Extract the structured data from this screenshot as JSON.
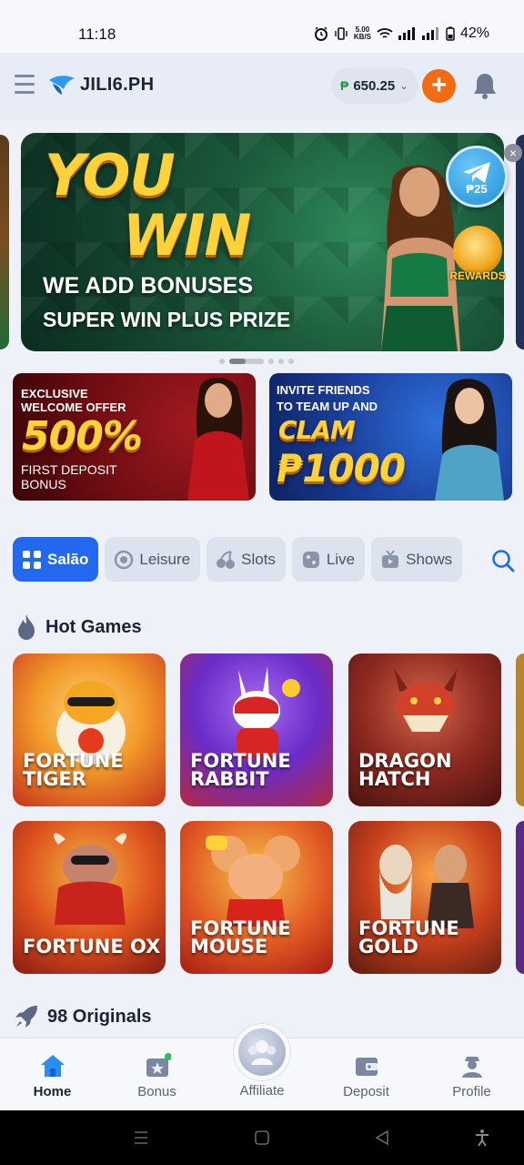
{
  "status_bar": {
    "time": "11:18",
    "speed_value": "5.00",
    "speed_unit": "KB/S",
    "battery": "42%"
  },
  "header": {
    "logo_text": "JILI6.PH",
    "currency_symbol": "₱",
    "balance": "650.25",
    "add_label": "+"
  },
  "banner": {
    "headline_line1": "YOU",
    "headline_line2": "WIN",
    "subline1": "WE ADD BONUSES",
    "subline2": "SUPER WIN PLUS PRIZE",
    "telegram_amount": "₱25",
    "rewards_label": "REWARDS",
    "close_label": "×"
  },
  "promos": [
    {
      "line1": "EXCLUSIVE",
      "line2": "WELCOME OFFER",
      "big": "500%",
      "line3": "FIRST DEPOSIT",
      "line4": "BONUS"
    },
    {
      "line1": "INVITE FRIENDS",
      "line2": "TO TEAM UP AND",
      "line3": "CLAM",
      "big": "₱1000"
    }
  ],
  "tabs": [
    {
      "label": "Salão",
      "icon": "grid-icon",
      "active": true
    },
    {
      "label": "Leisure",
      "icon": "target-icon"
    },
    {
      "label": "Slots",
      "icon": "cherry-icon"
    },
    {
      "label": "Live",
      "icon": "dice-icon"
    },
    {
      "label": "Shows",
      "icon": "tv-icon"
    }
  ],
  "hot_games": {
    "title": "Hot Games",
    "items": [
      {
        "line1": "FORTUNE",
        "line2": "TIGER"
      },
      {
        "line1": "FORTUNE",
        "line2": "RABBIT"
      },
      {
        "line1": "DRAGON",
        "line2": "HATCH"
      },
      {
        "line1": "FORTUNE OX",
        "line2": ""
      },
      {
        "line1": "FORTUNE",
        "line2": "MOUSE"
      },
      {
        "line1": "FORTUNE",
        "line2": "GOLD"
      }
    ]
  },
  "originals": {
    "title": "98 Originals"
  },
  "bottom_nav": [
    {
      "label": "Home",
      "icon": "home-icon",
      "active": true
    },
    {
      "label": "Bonus",
      "icon": "bonus-star-icon"
    },
    {
      "label": "Affiliate",
      "icon": "affiliate-icon"
    },
    {
      "label": "Deposit",
      "icon": "wallet-icon"
    },
    {
      "label": "Profile",
      "icon": "profile-icon"
    }
  ],
  "colors": {
    "accent_blue": "#2468f0",
    "add_orange": "#f26a12",
    "currency_green": "#1b9c3a"
  }
}
